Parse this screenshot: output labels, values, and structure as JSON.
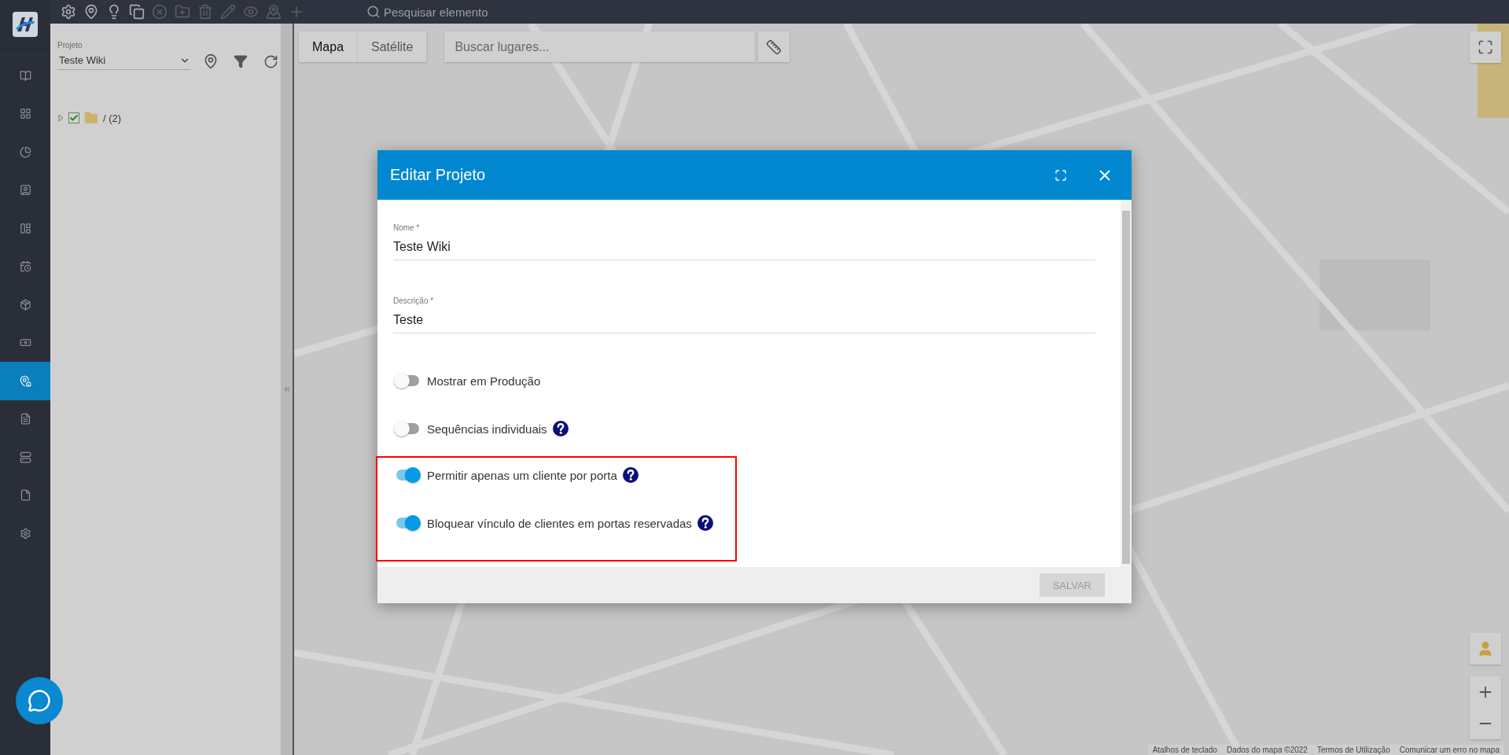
{
  "toolbar": {
    "buttons": [
      {
        "kind": "settings",
        "disabled": false
      },
      {
        "kind": "pin",
        "disabled": false
      },
      {
        "kind": "bulb",
        "disabled": false
      },
      {
        "kind": "copy",
        "disabled": false
      },
      {
        "kind": "cancel",
        "disabled": true
      },
      {
        "kind": "folder-add",
        "disabled": true
      },
      {
        "kind": "trash",
        "disabled": true
      },
      {
        "kind": "pencil",
        "disabled": true
      },
      {
        "kind": "eye",
        "disabled": true
      },
      {
        "kind": "pin-circle",
        "disabled": true
      },
      {
        "kind": "plus",
        "disabled": true
      }
    ],
    "search": {
      "placeholder": "Pesquisar elemento"
    }
  },
  "sidebar": {
    "items": [
      {
        "kind": "book",
        "selected": false
      },
      {
        "kind": "grid",
        "selected": false
      },
      {
        "kind": "pie",
        "selected": false
      },
      {
        "kind": "contact",
        "selected": false
      },
      {
        "kind": "board",
        "selected": false
      },
      {
        "kind": "calendar",
        "selected": false
      },
      {
        "kind": "box",
        "selected": false
      },
      {
        "kind": "money",
        "selected": false
      },
      {
        "kind": "map-pin",
        "selected": true
      },
      {
        "kind": "list",
        "selected": false
      },
      {
        "kind": "server",
        "selected": false
      },
      {
        "kind": "file",
        "selected": false
      },
      {
        "kind": "settings",
        "selected": false
      }
    ]
  },
  "project_panel": {
    "label": "Projeto",
    "value": "Teste Wiki",
    "tree": [
      {
        "label": "/ (2)",
        "checked": true,
        "expanded": false
      }
    ]
  },
  "map": {
    "types": [
      {
        "label": "Mapa",
        "selected": true
      },
      {
        "label": "Satélite",
        "selected": false
      }
    ],
    "search": {
      "placeholder": "Buscar lugares..."
    },
    "footer_links": [
      "Atalhos de teclado",
      "Dados do mapa ©2022",
      "Termos de Utilização",
      "Comunicar um erro no mapa"
    ]
  },
  "dialog": {
    "title": "Editar Projeto",
    "fields": [
      {
        "label": "Nome *",
        "value": "Teste Wiki"
      },
      {
        "label": "Descrição *",
        "value": "Teste"
      }
    ],
    "toggles": [
      {
        "label": "Mostrar em Produção",
        "on": false,
        "help": false,
        "highlighted": false
      },
      {
        "label": "Sequências individuais",
        "on": false,
        "help": true,
        "highlighted": false
      },
      {
        "label": "Permitir apenas um cliente por porta",
        "on": true,
        "help": true,
        "highlighted": true
      },
      {
        "label": "Bloquear vínculo de clientes em portas reservadas",
        "on": true,
        "help": true,
        "highlighted": true
      }
    ],
    "save_button": {
      "label": "SALVAR",
      "disabled": true
    }
  }
}
